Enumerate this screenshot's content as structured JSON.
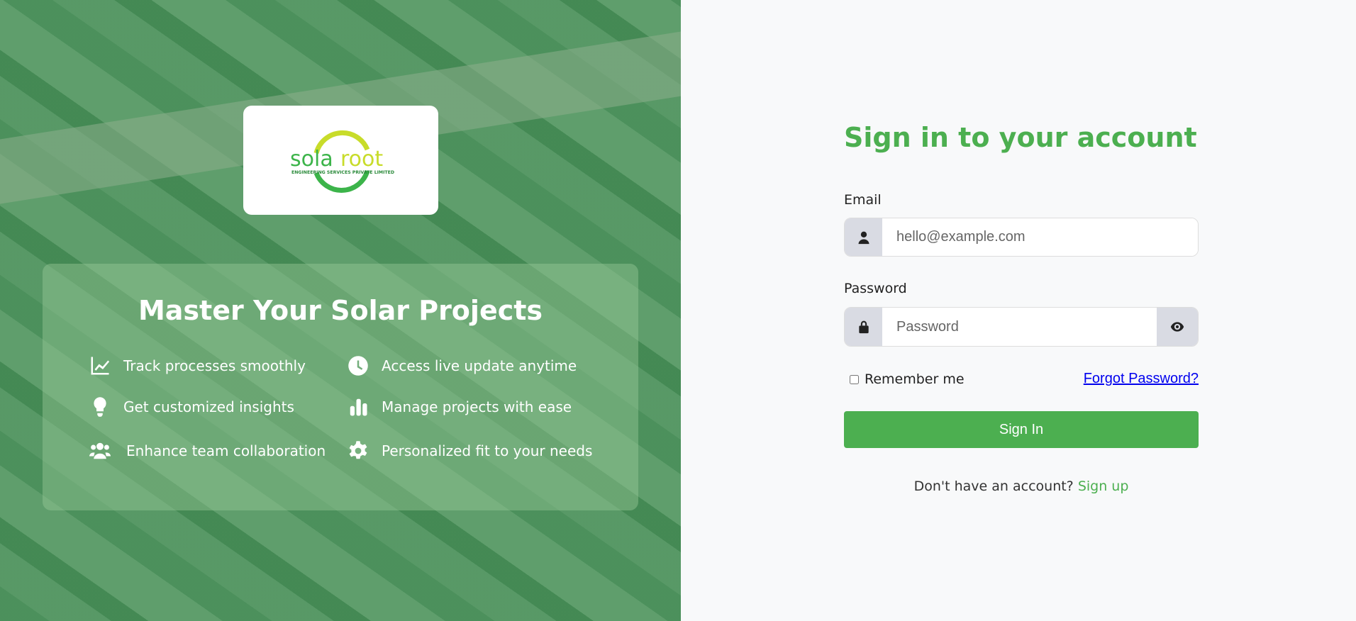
{
  "brand": {
    "name": "solaroot",
    "tagline": "ENGINEERING SERVICES PRIVATE LIMITED"
  },
  "promo": {
    "title": "Master Your Solar Projects",
    "features": [
      {
        "icon": "chart-line-icon",
        "label": "Track processes smoothly"
      },
      {
        "icon": "clock-icon",
        "label": "Access live update anytime"
      },
      {
        "icon": "lightbulb-icon",
        "label": "Get customized insights"
      },
      {
        "icon": "bar-chart-icon",
        "label": "Manage projects with ease"
      },
      {
        "icon": "users-icon",
        "label": "Enhance team collaboration"
      },
      {
        "icon": "gear-icon",
        "label": "Personalized fit to your needs"
      }
    ]
  },
  "form": {
    "title": "Sign in to your account",
    "email_label": "Email",
    "email_placeholder": "hello@example.com",
    "password_label": "Password",
    "password_placeholder": "Password",
    "remember": "Remember me",
    "forgot": "Forgot Password?",
    "submit": "Sign In",
    "no_account": "Don't have an account?",
    "signup": "Sign up"
  },
  "colors": {
    "accent": "#4caf50"
  }
}
